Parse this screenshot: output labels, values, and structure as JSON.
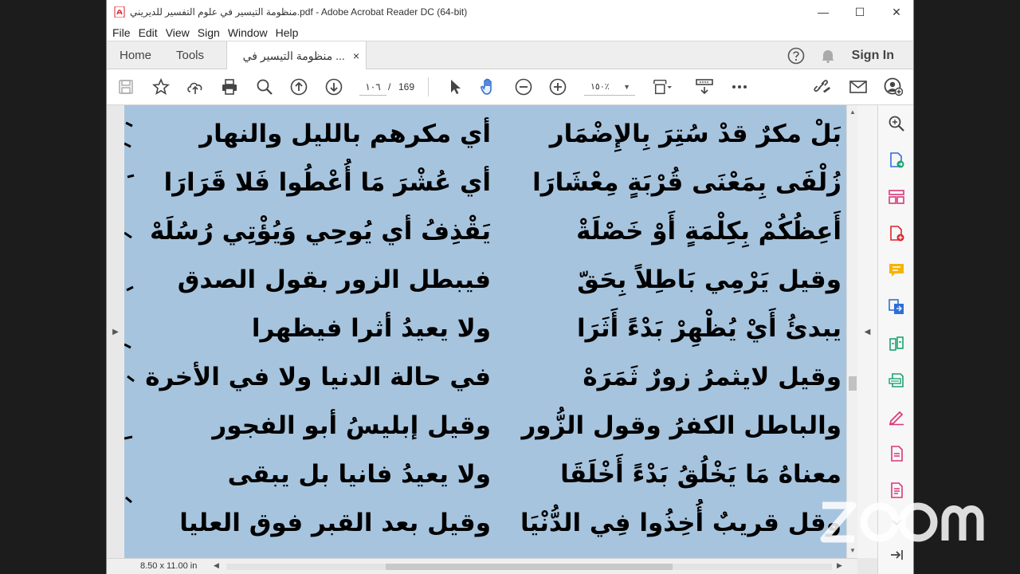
{
  "window": {
    "title": "منظومة التيسير في علوم التفسير للديريني.pdf - Adobe Acrobat Reader DC (64-bit)",
    "minimize_glyph": "—",
    "maximize_glyph": "☐",
    "close_glyph": "✕"
  },
  "menu": [
    "File",
    "Edit",
    "View",
    "Sign",
    "Window",
    "Help"
  ],
  "tabs": {
    "home": "Home",
    "tools": "Tools",
    "document": "منظومة التيسير في ...",
    "document_close": "×",
    "signin": "Sign In"
  },
  "toolbar": {
    "current_page": "١٠٦",
    "page_separator": "/",
    "total_pages": "169",
    "zoom": "١٥٠٪",
    "zoom_caret": "▼",
    "icons": [
      "save-icon",
      "bookmark-star-icon",
      "upload-cloud-icon",
      "print-icon",
      "search-zoom-icon",
      "page-up-icon",
      "page-down-icon",
      "select-arrow-icon",
      "hand-tool-icon",
      "zoom-out-icon",
      "zoom-in-icon",
      "page-fit-icon",
      "scroll-mode-icon",
      "more-icon",
      "share-link-icon",
      "email-icon",
      "add-user-icon"
    ]
  },
  "document": {
    "right_column": [
      "بَلْ مكرٌ قدْ سُتِرَ بِالإِضْمَار",
      "زُلْفَى بِمَعْنَى قُرْبَةٍ مِعْشَارَا",
      "أَعِظُكُمْ بِكِلْمَةٍ أَوْ خَصْلَةْ",
      "وقيل يَرْمِي بَاطِلاً بِحَقّ",
      "يبدئُ أَيْ يُظْهِرْ بَدْءً أَثَرَا",
      "وقيل لايثمرُ زورٌ ثَمَرَهْ",
      "والباطل الكفرُ وقول الزُّور",
      "معناهُ مَا يَخْلُقُ بَدْءً أَخْلَقَا",
      "وقل قريبٌ أُخِذُوا فِي الدُّنْيَا"
    ],
    "left_column": [
      "أي مكرهم بالليل والنهار",
      "أي عُشْرَ مَا أُعْطُوا فَلا قَرَارَا",
      "يَقْذِفُ أي يُوحِي وَيُؤْتِي رُسُلَهْ",
      "فيبطل الزور بقول الصدق",
      "ولا يعيدُ أثرا فيظهرا",
      "في حالة الدنيا ولا في الأخرة",
      "وقيل إبليسُ أبو الفجور",
      "ولا يعيدُ فانيا بل يبقى",
      "وقيل بعد القبر فوق العليا"
    ],
    "page_size": "8.50 x 11.00 in"
  },
  "tools_pane": [
    "search-doc-icon",
    "export-pdf-icon",
    "organize-pages-icon",
    "create-pdf-icon",
    "comment-icon",
    "combine-files-icon",
    "compress-icon",
    "scan-icon",
    "fill-sign-icon",
    "protect-icon",
    "edit-pdf-icon",
    "expand-pane-icon"
  ],
  "watermark": "zoom",
  "colors": {
    "page_background": "#a6c4de",
    "acrobat_red": "#d8262d",
    "tool_green": "#1aa36f",
    "tool_blue": "#2e6fd7",
    "tool_yellow": "#f4b400",
    "tool_pink": "#d9387a",
    "tool_purple": "#7b4fd4"
  }
}
